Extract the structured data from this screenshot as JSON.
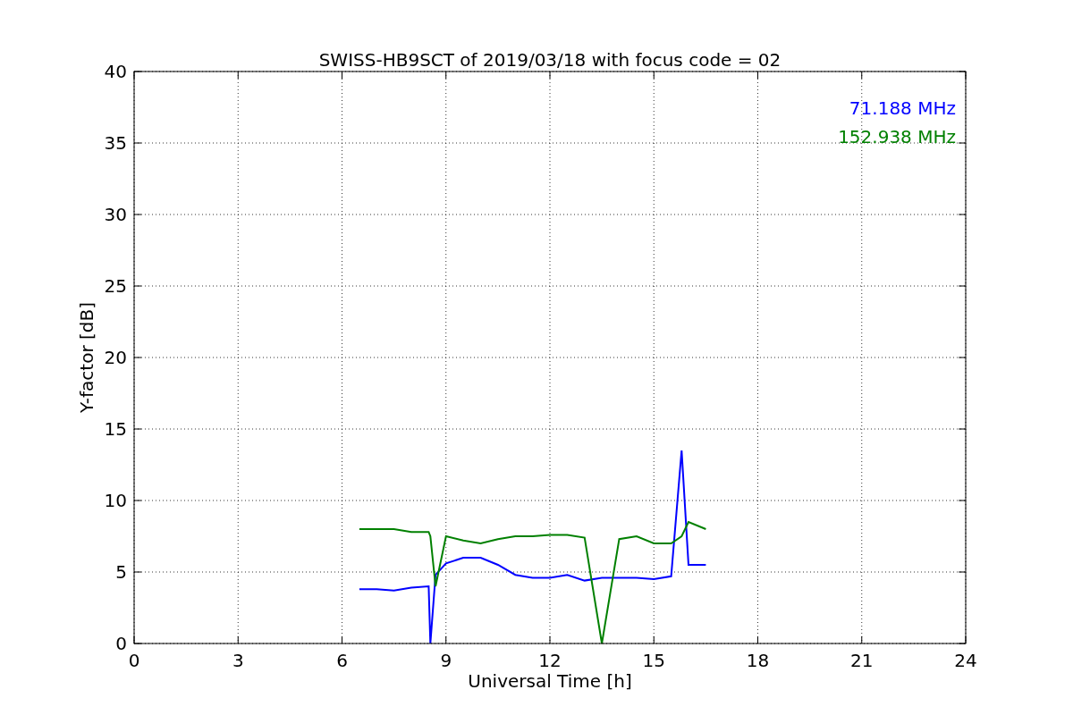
{
  "chart_data": {
    "type": "line",
    "title": "SWISS-HB9SCT of 2019/03/18 with focus code = 02",
    "xlabel": "Universal Time [h]",
    "ylabel": "Y-factor [dB]",
    "x": [
      6.5,
      7,
      7.5,
      8,
      8.5,
      8.55,
      8.7,
      9,
      9.5,
      10,
      10.5,
      11,
      11.5,
      12,
      12.5,
      13,
      13.5,
      14,
      14.5,
      15,
      15.5,
      15.8,
      16,
      16.5
    ],
    "series": [
      {
        "name": "71.188 MHz",
        "color": "#0000ff",
        "values": [
          3.8,
          3.8,
          3.7,
          3.9,
          4.0,
          0,
          4.8,
          5.6,
          6.0,
          6.0,
          5.5,
          4.8,
          4.6,
          4.6,
          4.8,
          4.4,
          4.6,
          4.6,
          4.6,
          4.5,
          4.7,
          13.5,
          5.5,
          5.5
        ]
      },
      {
        "name": "152.938 MHz",
        "color": "#008000",
        "values": [
          8.0,
          8.0,
          8.0,
          7.8,
          7.8,
          7.5,
          4.0,
          7.5,
          7.2,
          7.0,
          7.3,
          7.5,
          7.5,
          7.6,
          7.6,
          7.4,
          0,
          7.3,
          7.5,
          7.0,
          7.0,
          7.5,
          8.5,
          8.0
        ]
      }
    ],
    "grid": true,
    "xlim": [
      0,
      24
    ],
    "ylim": [
      0,
      40
    ],
    "xticks": [
      0,
      3,
      6,
      9,
      12,
      15,
      18,
      21,
      24
    ],
    "yticks": [
      0,
      5,
      10,
      15,
      20,
      25,
      30,
      35,
      40
    ]
  }
}
